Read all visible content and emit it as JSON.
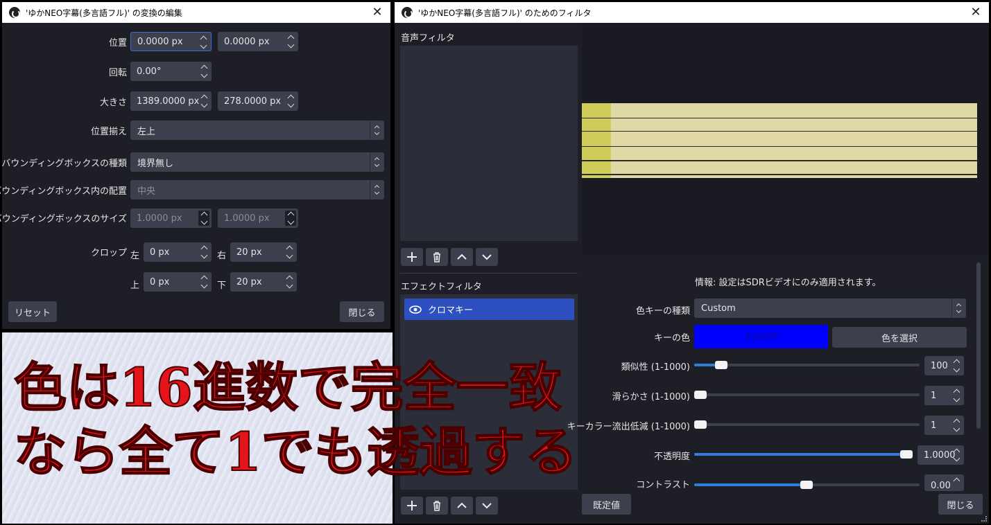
{
  "transform": {
    "title": "'ゆかNEO字幕(多言語フル)' の変換の編集",
    "position_label": "位置",
    "position_x": "0.0000 px",
    "position_y": "0.0000 px",
    "rotation_label": "回転",
    "rotation": "0.00°",
    "size_label": "大きさ",
    "size_w": "1389.0000 px",
    "size_h": "278.0000 px",
    "alignment_label": "位置揃え",
    "alignment": "左上",
    "bbox_type_label": "バウンディングボックスの種類",
    "bbox_type": "境界無し",
    "bbox_align_label": "バウンディングボックス内の配置",
    "bbox_align": "中央",
    "bbox_size_label": "バウンディングボックスのサイズ",
    "bbox_w": "1.0000 px",
    "bbox_h": "1.0000 px",
    "crop_label": "クロップ",
    "crop_left_label": "左",
    "crop_left": "0 px",
    "crop_right_label": "右",
    "crop_right": "20 px",
    "crop_top_label": "上",
    "crop_top": "0 px",
    "crop_bottom_label": "下",
    "crop_bottom": "20 px",
    "reset_button": "リセット",
    "close_button": "閉じる"
  },
  "filters": {
    "title": "'ゆかNEO字幕(多言語フル)' のためのフィルタ",
    "audio_filters_label": "音声フィルタ",
    "effect_filters_label": "エフェクトフィルタ",
    "effect_items": [
      "クロマキー"
    ],
    "info": "情報: 設定はSDRビデオにのみ適用されます。",
    "key_type_label": "色キーの種類",
    "key_type": "Custom",
    "key_color_label": "キーの色",
    "key_color_value": "#0000ff",
    "key_color_hex": "#0000ff",
    "select_color_button": "色を選択",
    "similarity_label": "類似性 (1-1000)",
    "similarity": "100",
    "similarity_fraction": 0.099,
    "smoothness_label": "滑らかさ (1-1000)",
    "smoothness": "1",
    "spill_label": "キーカラー流出低減 (1-1000)",
    "spill": "1",
    "opacity_label": "不透明度",
    "opacity": "1.0000",
    "contrast_label": "コントラスト",
    "contrast": "0.00",
    "defaults_button": "既定値",
    "close_button": "閉じる"
  },
  "overlay": {
    "line1": "色は16進数で完全一致",
    "line2": "なら全て1でも透過する"
  },
  "colors": {
    "accent": "#2f7fd9",
    "selected_filter": "#2d4fbf",
    "overlay_text": "#e3151a",
    "preview_fill": "#e0d9a6"
  }
}
